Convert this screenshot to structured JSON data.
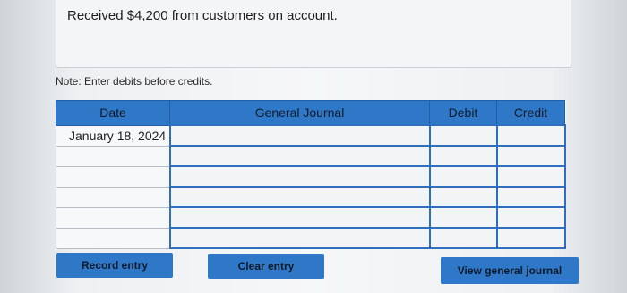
{
  "prompt": {
    "text": "Received $4,200 from customers on account."
  },
  "note": "Note: Enter debits before credits.",
  "journal": {
    "headers": [
      "Date",
      "General Journal",
      "Debit",
      "Credit"
    ],
    "rows": [
      {
        "date": "January 18, 2024",
        "account": "",
        "debit": "",
        "credit": ""
      },
      {
        "date": "",
        "account": "",
        "debit": "",
        "credit": ""
      },
      {
        "date": "",
        "account": "",
        "debit": "",
        "credit": ""
      },
      {
        "date": "",
        "account": "",
        "debit": "",
        "credit": ""
      },
      {
        "date": "",
        "account": "",
        "debit": "",
        "credit": ""
      },
      {
        "date": "",
        "account": "",
        "debit": "",
        "credit": ""
      }
    ]
  },
  "buttons": {
    "record": "Record entry",
    "clear": "Clear entry",
    "view": "View general journal"
  },
  "colors": {
    "header_bg": "#2f78c8",
    "button_bg": "#2f78c8",
    "input_border": "#2f6fbf"
  }
}
